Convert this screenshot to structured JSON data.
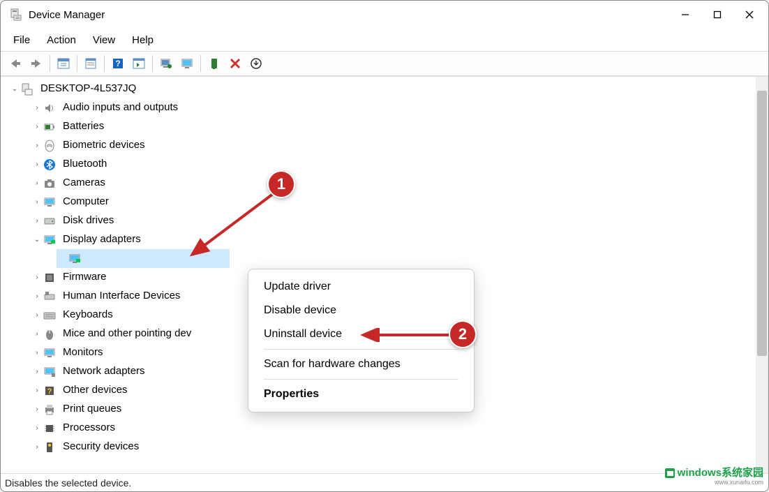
{
  "window": {
    "title": "Device Manager"
  },
  "menu": {
    "file": "File",
    "action": "Action",
    "view": "View",
    "help": "Help"
  },
  "tree": {
    "root": "DESKTOP-4L537JQ",
    "categories": [
      {
        "label": "Audio inputs and outputs",
        "expanded": false
      },
      {
        "label": "Batteries",
        "expanded": false
      },
      {
        "label": "Biometric devices",
        "expanded": false
      },
      {
        "label": "Bluetooth",
        "expanded": false
      },
      {
        "label": "Cameras",
        "expanded": false
      },
      {
        "label": "Computer",
        "expanded": false
      },
      {
        "label": "Disk drives",
        "expanded": false
      },
      {
        "label": "Display adapters",
        "expanded": true,
        "child_selected": true
      },
      {
        "label": "Firmware",
        "expanded": false
      },
      {
        "label": "Human Interface Devices",
        "expanded": false
      },
      {
        "label": "Keyboards",
        "expanded": false
      },
      {
        "label": "Mice and other pointing dev",
        "expanded": false
      },
      {
        "label": "Monitors",
        "expanded": false
      },
      {
        "label": "Network adapters",
        "expanded": false
      },
      {
        "label": "Other devices",
        "expanded": false
      },
      {
        "label": "Print queues",
        "expanded": false
      },
      {
        "label": "Processors",
        "expanded": false
      },
      {
        "label": "Security devices",
        "expanded": false
      }
    ]
  },
  "context_menu": {
    "update": "Update driver",
    "disable": "Disable device",
    "uninstall": "Uninstall device",
    "scan": "Scan for hardware changes",
    "properties": "Properties"
  },
  "status": "Disables the selected device.",
  "annotations": {
    "b1": "1",
    "b2": "2"
  },
  "watermark": {
    "brand": "windows系统家园",
    "url": "www.xunaifu.com"
  }
}
